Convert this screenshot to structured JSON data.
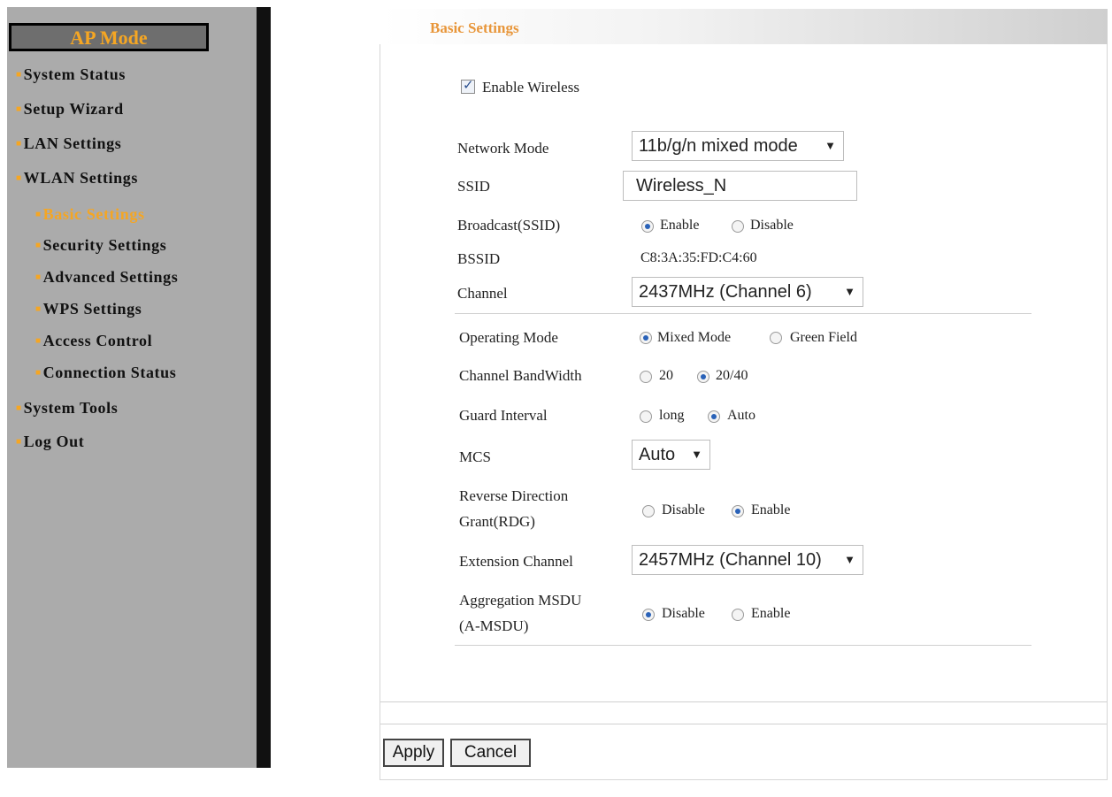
{
  "sidebar": {
    "mode_title": "AP Mode",
    "items": [
      {
        "label": "System Status"
      },
      {
        "label": "Setup Wizard"
      },
      {
        "label": "LAN Settings"
      },
      {
        "label": "WLAN Settings"
      },
      {
        "label": "Basic Settings"
      },
      {
        "label": "Security Settings"
      },
      {
        "label": "Advanced Settings"
      },
      {
        "label": "WPS Settings"
      },
      {
        "label": "Access Control"
      },
      {
        "label": "Connection Status"
      },
      {
        "label": "System Tools"
      },
      {
        "label": "Log Out"
      }
    ],
    "active_item": "Basic Settings"
  },
  "header": {
    "title": "Basic Settings"
  },
  "form": {
    "enable_wireless": {
      "label": "Enable Wireless",
      "checked": true
    },
    "network_mode": {
      "label": "Network Mode",
      "value": "11b/g/n mixed mode"
    },
    "ssid": {
      "label": "SSID",
      "value": "Wireless_N"
    },
    "broadcast": {
      "label": "Broadcast(SSID)",
      "opt1": "Enable",
      "opt2": "Disable",
      "selected": "Enable"
    },
    "bssid": {
      "label": "BSSID",
      "value": "C8:3A:35:FD:C4:60"
    },
    "channel": {
      "label": "Channel",
      "value": "2437MHz (Channel 6)"
    },
    "operating_mode": {
      "label": "Operating Mode",
      "opt1": "Mixed Mode",
      "opt2": "Green Field",
      "selected": "Mixed Mode"
    },
    "bandwidth": {
      "label": "Channel BandWidth",
      "opt1": "20",
      "opt2": "20/40",
      "selected": "20/40"
    },
    "guard_interval": {
      "label": "Guard Interval",
      "opt1": "long",
      "opt2": "Auto",
      "selected": "Auto"
    },
    "mcs": {
      "label": "MCS",
      "value": "Auto"
    },
    "rdg": {
      "label_line1": "Reverse Direction",
      "label_line2": "Grant(RDG)",
      "opt1": "Disable",
      "opt2": "Enable",
      "selected": "Enable"
    },
    "extension_channel": {
      "label": "Extension Channel",
      "value": "2457MHz (Channel 10)"
    },
    "amsdu": {
      "label_line1": "Aggregation MSDU",
      "label_line2": "(A-MSDU)",
      "opt1": "Disable",
      "opt2": "Enable",
      "selected": "Disable"
    }
  },
  "buttons": {
    "apply": "Apply",
    "cancel": "Cancel"
  },
  "colors": {
    "accent": "#f5a623",
    "sidebar_bg": "#ababab",
    "header_title": "#e8963a",
    "radio_selected": "#2a62b8"
  },
  "icons": {
    "bullet": "orange-square-bullet",
    "dropdown": "caret-down",
    "check": "checkmark"
  }
}
